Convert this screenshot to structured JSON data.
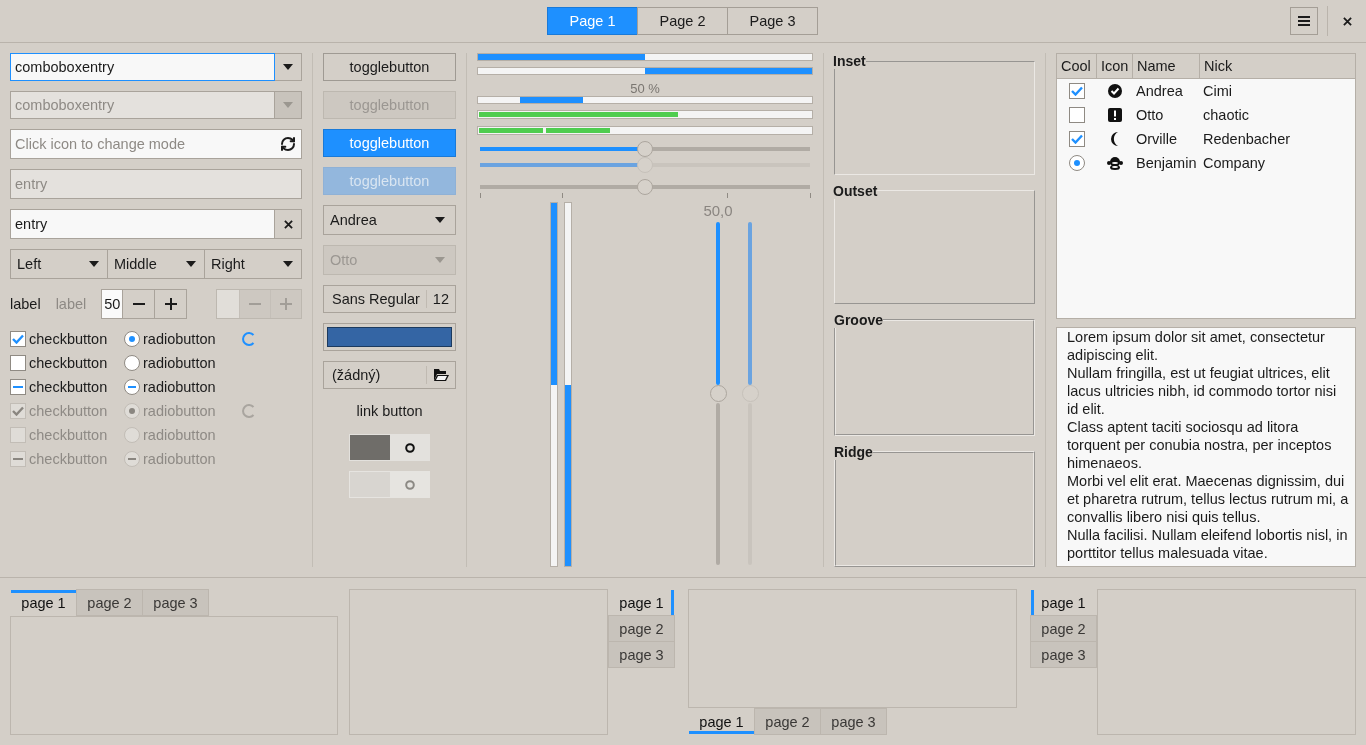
{
  "header": {
    "pages": [
      {
        "label": "Page 1",
        "selected": true
      },
      {
        "label": "Page 2",
        "selected": false
      },
      {
        "label": "Page 3",
        "selected": false
      }
    ]
  },
  "combo_entries": [
    {
      "value": "comboboxentry",
      "disabled": false,
      "focused": true
    },
    {
      "value": "comboboxentry",
      "disabled": true,
      "focused": false
    }
  ],
  "entries": [
    {
      "kind": "mode",
      "placeholder": "Click icon to change mode",
      "disabled": false
    },
    {
      "kind": "plain",
      "value": "entry",
      "disabled": true
    },
    {
      "kind": "clear",
      "value": "entry",
      "disabled": false
    }
  ],
  "linked_combos": [
    {
      "label": "Left"
    },
    {
      "label": "Middle"
    },
    {
      "label": "Right"
    }
  ],
  "labels": [
    {
      "text": "label",
      "disabled": false
    },
    {
      "text": "label",
      "disabled": true
    }
  ],
  "spin_buttons": [
    {
      "value": "50",
      "disabled": false
    },
    {
      "disabled": true
    }
  ],
  "toggle_rows": [
    {
      "check": {
        "label": "checkbutton",
        "checked": true
      },
      "radio": {
        "label": "radiobutton",
        "selected": true
      },
      "spinner": true,
      "disabled": false
    },
    {
      "check": {
        "label": "checkbutton",
        "checked": false
      },
      "radio": {
        "label": "radiobutton",
        "selected": false
      },
      "spinner": false,
      "disabled": false
    },
    {
      "check": {
        "label": "checkbutton",
        "mixed": true
      },
      "radio": {
        "label": "radiobutton",
        "mixed": true
      },
      "spinner": false,
      "disabled": false
    },
    {
      "check": {
        "label": "checkbutton",
        "checked": true
      },
      "radio": {
        "label": "radiobutton",
        "selected": true
      },
      "spinner": true,
      "disabled": true
    },
    {
      "check": {
        "label": "checkbutton",
        "checked": false
      },
      "radio": {
        "label": "radiobutton",
        "selected": false
      },
      "spinner": false,
      "disabled": true
    },
    {
      "check": {
        "label": "checkbutton",
        "mixed": true
      },
      "radio": {
        "label": "radiobutton",
        "mixed": true
      },
      "spinner": false,
      "disabled": true
    }
  ],
  "toggle_buttons": [
    {
      "label": "togglebutton",
      "active": false,
      "disabled": false
    },
    {
      "label": "togglebutton",
      "active": false,
      "disabled": true
    },
    {
      "label": "togglebutton",
      "active": true,
      "disabled": false
    },
    {
      "label": "togglebutton",
      "active": true,
      "disabled": true
    }
  ],
  "combos": [
    {
      "value": "Andrea",
      "disabled": false
    },
    {
      "value": "Otto",
      "disabled": true
    }
  ],
  "font_button": {
    "family": "Sans Regular",
    "size": "12"
  },
  "color_button": {
    "color": "#3465a4"
  },
  "file_button": {
    "value": "(žádný)"
  },
  "link_button": {
    "label": "link button"
  },
  "switches": [
    {
      "on": false,
      "disabled": false
    },
    {
      "on": false,
      "disabled": true
    }
  ],
  "progress_bars": [
    {
      "level": 0.5,
      "inverted": false
    },
    {
      "level": 0.5,
      "inverted": true
    }
  ],
  "pulse_bar": {
    "text": "50 %",
    "level": 0.19
  },
  "level_bars": [
    {
      "kind": "continuous",
      "level": 0.6
    },
    {
      "kind": "discrete",
      "level": 0.4
    }
  ],
  "scales": [
    {
      "level": 0.5,
      "disabled": false,
      "origin": true,
      "marks": false
    },
    {
      "level": 0.5,
      "disabled": true,
      "origin": true,
      "marks": false
    },
    {
      "level": 0.5,
      "disabled": false,
      "origin": false,
      "marks": true
    }
  ],
  "vertical_progress": [
    {
      "level": 0.5,
      "inverted": false
    },
    {
      "level": 0.5,
      "inverted": true
    }
  ],
  "vertical_scales": [
    {
      "level": 0.5,
      "disabled": false,
      "value": "50,0"
    },
    {
      "level": 0.5,
      "disabled": true
    }
  ],
  "frames": [
    {
      "label": "Inset",
      "kind": "inset"
    },
    {
      "label": "Outset",
      "kind": "outset"
    },
    {
      "label": "Groove",
      "kind": "groove"
    },
    {
      "label": "Ridge",
      "kind": "ridge"
    }
  ],
  "tree": {
    "columns": [
      "Cool",
      "Icon",
      "Name",
      "Nick"
    ],
    "rows": [
      {
        "radio": false,
        "active": true,
        "kind": "ok",
        "name": "Andrea",
        "nick": "Cimi"
      },
      {
        "radio": false,
        "active": false,
        "kind": "warning",
        "name": "Otto",
        "nick": "chaotic"
      },
      {
        "radio": false,
        "active": true,
        "kind": "night",
        "name": "Orville",
        "nick": "Redenbacher"
      },
      {
        "radio": true,
        "active": true,
        "kind": "animal",
        "name": "Benjamin",
        "nick": "Company"
      }
    ]
  },
  "text_view": {
    "paragraphs": [
      "Lorem ipsum dolor sit amet, consectetur adipiscing elit.",
      "Nullam fringilla, est ut feugiat ultrices, elit lacus ultricies nibh, id commodo tortor nisi id elit.",
      "Class aptent taciti sociosqu ad litora torquent per conubia nostra, per inceptos himenaeos.",
      "Morbi vel elit erat. Maecenas dignissim, dui et pharetra rutrum, tellus lectus rutrum mi, a convallis libero nisi quis tellus.",
      "Nulla facilisi. Nullam eleifend lobortis nisl, in porttitor tellus malesuada vitae."
    ]
  },
  "notebooks": [
    {
      "kind": "top",
      "tabs": [
        {
          "label": "page 1",
          "selected": true
        },
        {
          "label": "page 2",
          "selected": false
        },
        {
          "label": "page 3",
          "selected": false
        }
      ]
    },
    {
      "kind": "right",
      "tabs": [
        {
          "label": "page 1",
          "selected": true
        },
        {
          "label": "page 2",
          "selected": false
        },
        {
          "label": "page 3",
          "selected": false
        }
      ]
    },
    {
      "kind": "bottom",
      "tabs": [
        {
          "label": "page 1",
          "selected": true
        },
        {
          "label": "page 2",
          "selected": false
        },
        {
          "label": "page 3",
          "selected": false
        }
      ]
    },
    {
      "kind": "left",
      "tabs": [
        {
          "label": "page 1",
          "selected": true
        },
        {
          "label": "page 2",
          "selected": false
        },
        {
          "label": "page 3",
          "selected": false
        }
      ]
    }
  ]
}
